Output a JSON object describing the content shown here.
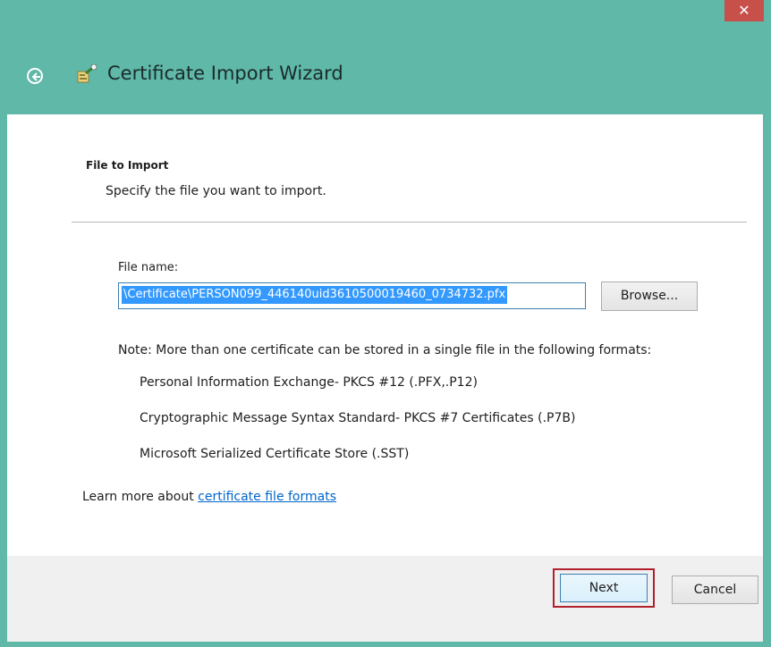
{
  "window": {
    "title": "Certificate Import Wizard",
    "close_symbol": "✕",
    "accent_color": "#5fb8a8"
  },
  "page": {
    "section_title": "File to Import",
    "section_description": "Specify the file you want to import.",
    "file_label": "File name:",
    "file_value": "\\Certificate\\PERSON099_446140uid3610500019460_0734732.pfx",
    "browse_label": "Browse...",
    "note": "Note:  More than one certificate can be stored in a single file in the following formats:",
    "formats": [
      "Personal Information Exchange- PKCS #12 (.PFX,.P12)",
      "Cryptographic Message Syntax Standard- PKCS #7 Certificates (.P7B)",
      "Microsoft Serialized Certificate Store (.SST)"
    ],
    "learn_prefix": "Learn more about ",
    "learn_link": "certificate file formats"
  },
  "footer": {
    "next_label": "Next",
    "cancel_label": "Cancel"
  },
  "icons": {
    "back": "back-arrow-icon",
    "wizard": "certificate-wizard-icon",
    "close": "close-icon"
  }
}
